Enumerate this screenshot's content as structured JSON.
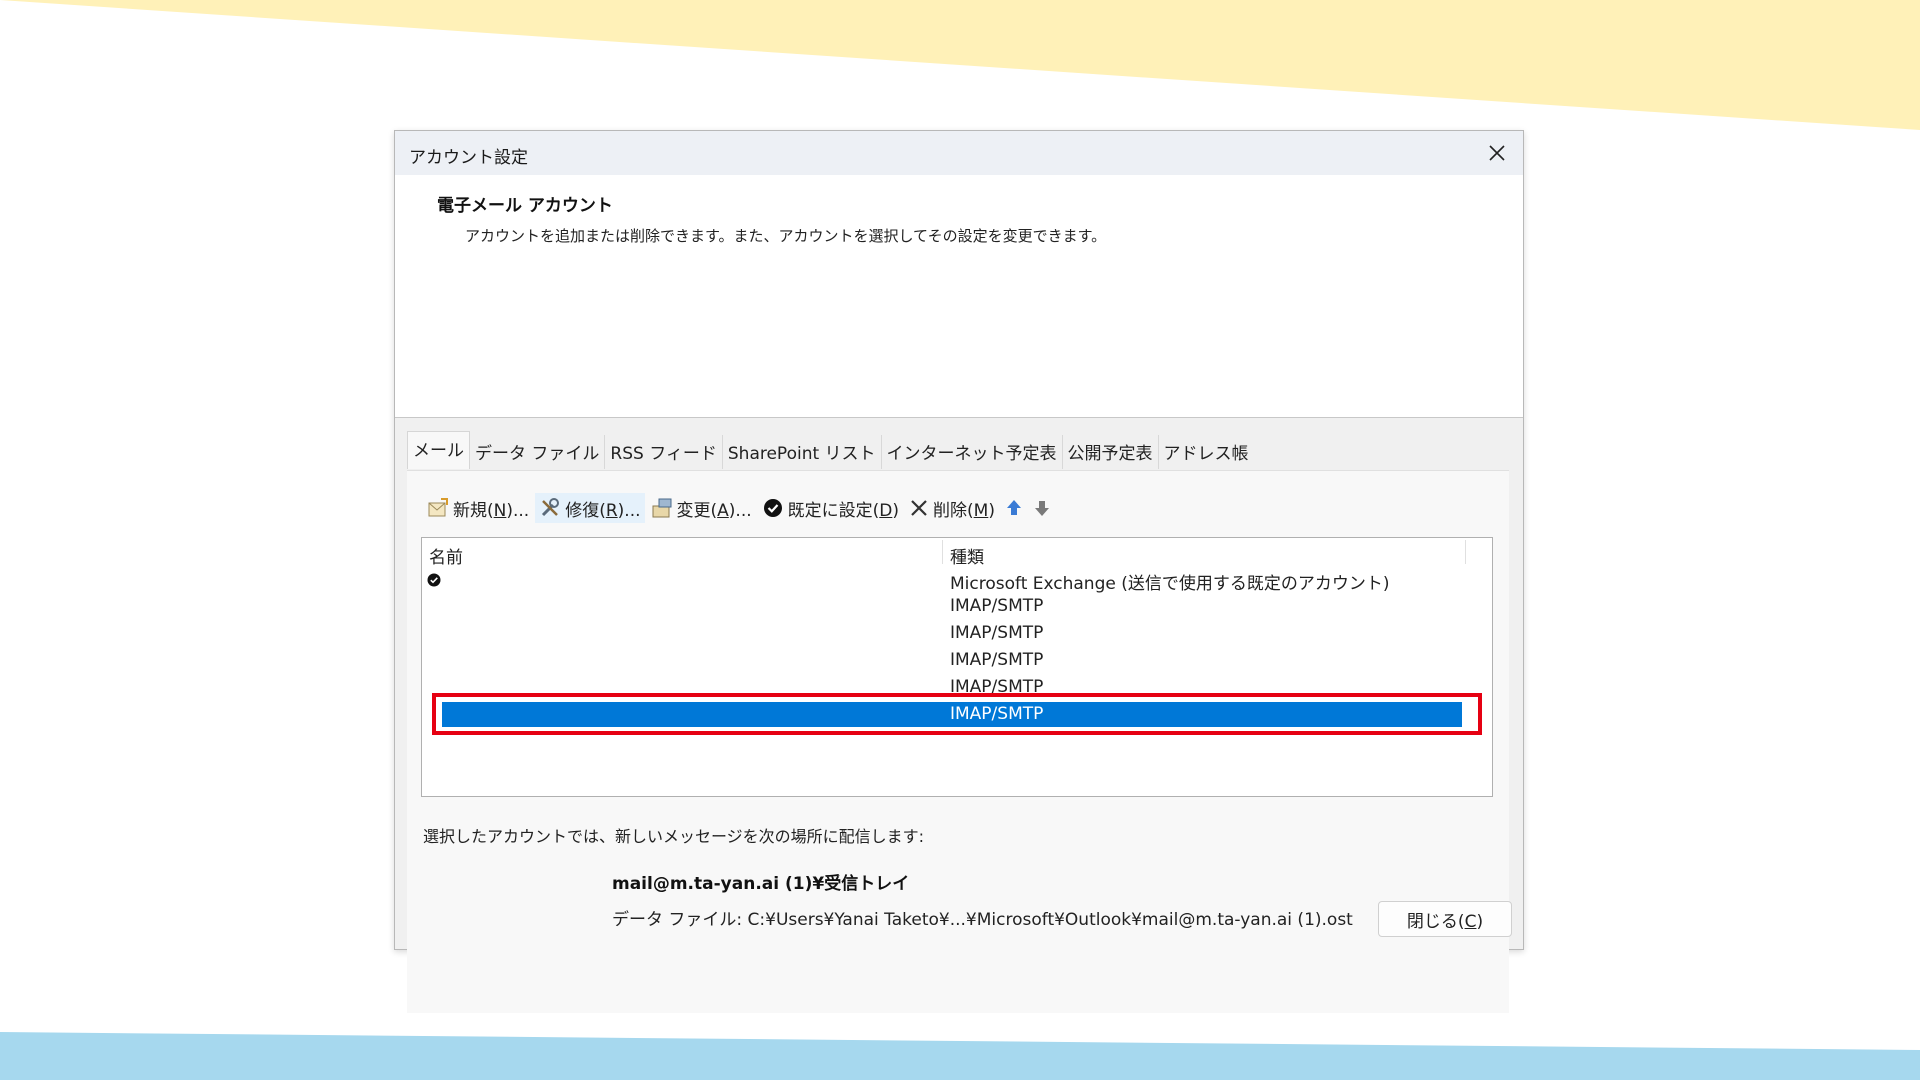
{
  "colors": {
    "top_band": "#fff1b8",
    "bottom_band": "#a6d8ee",
    "selection": "#0078d7",
    "highlight_box": "#e60012"
  },
  "window": {
    "title": "アカウント設定",
    "close_icon": "close-icon"
  },
  "header": {
    "title": "電子メール アカウント",
    "description": "アカウントを追加または削除できます。また、アカウントを選択してその設定を変更できます。"
  },
  "tabs": [
    {
      "label": "メール",
      "active": true
    },
    {
      "label": "データ ファイル"
    },
    {
      "label": "RSS フィード"
    },
    {
      "label": "SharePoint リスト"
    },
    {
      "label": "インターネット予定表"
    },
    {
      "label": "公開予定表"
    },
    {
      "label": "アドレス帳"
    }
  ],
  "toolbar": {
    "new_label": "新規(",
    "new_key": "N",
    "new_suffix": ")...",
    "repair_label": "修復(",
    "repair_key": "R",
    "repair_suffix": ")...",
    "change_label": "変更(",
    "change_key": "A",
    "change_suffix": ")...",
    "default_label": "既定に設定(",
    "default_key": "D",
    "default_suffix": ")",
    "delete_label": "削除(",
    "delete_key": "M",
    "delete_suffix": ")"
  },
  "account_list": {
    "col_name": "名前",
    "col_type": "種類",
    "rows": [
      {
        "type": "Microsoft Exchange (送信で使用する既定のアカウント)",
        "default": true
      },
      {
        "type": "IMAP/SMTP"
      },
      {
        "type": "IMAP/SMTP"
      },
      {
        "type": "IMAP/SMTP"
      },
      {
        "type": "IMAP/SMTP"
      },
      {
        "type": "IMAP/SMTP",
        "selected": true
      }
    ]
  },
  "delivery": {
    "label": "選択したアカウントでは、新しいメッセージを次の場所に配信します:",
    "folder": "mail@m.ta-yan.ai (1)¥受信トレイ",
    "data_file": "データ ファイル: C:¥Users¥Yanai Taketo¥...¥Microsoft¥Outlook¥mail@m.ta-yan.ai (1).ost"
  },
  "footer": {
    "close_label": "閉じる(",
    "close_key": "C",
    "close_suffix": ")"
  }
}
